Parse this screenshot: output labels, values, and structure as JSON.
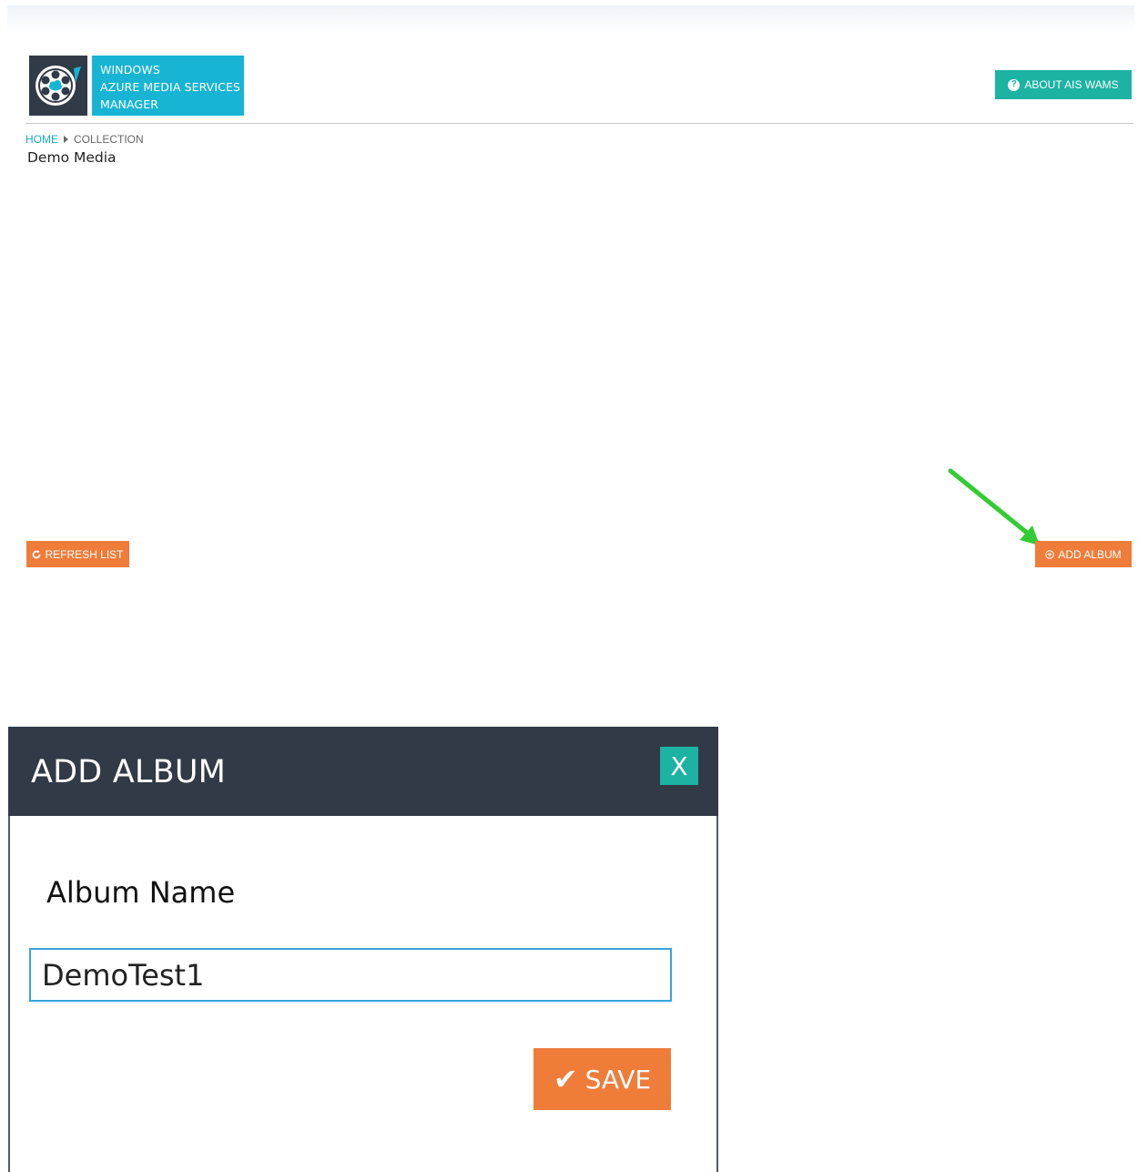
{
  "app": {
    "logo_lines": [
      "WINDOWS",
      "AZURE MEDIA SERVICES",
      "MANAGER"
    ],
    "about_button": "ABOUT AIS WAMS"
  },
  "breadcrumb": {
    "home": "HOME",
    "current": "COLLECTION"
  },
  "page": {
    "title": "Demo Media"
  },
  "actions": {
    "refresh_label": "REFRESH LIST",
    "add_album_label": "ADD ALBUM"
  },
  "modal": {
    "title": "ADD ALBUM",
    "close_label": "X",
    "field_label": "Album Name",
    "album_name_value": "DemoTest1",
    "save_label": "SAVE"
  },
  "colors": {
    "teal": "#1cb3a3",
    "cyan": "#18b4d3",
    "orange": "#f07c3a",
    "dark": "#313a46",
    "arrow_green": "#33cc33"
  },
  "icons": {
    "logo": "film-reel-cloud-icon",
    "about": "question-circle-icon",
    "refresh": "refresh-icon",
    "add": "plus-circle-icon",
    "save": "checkmark-icon",
    "annotation": "green-arrow-icon"
  }
}
